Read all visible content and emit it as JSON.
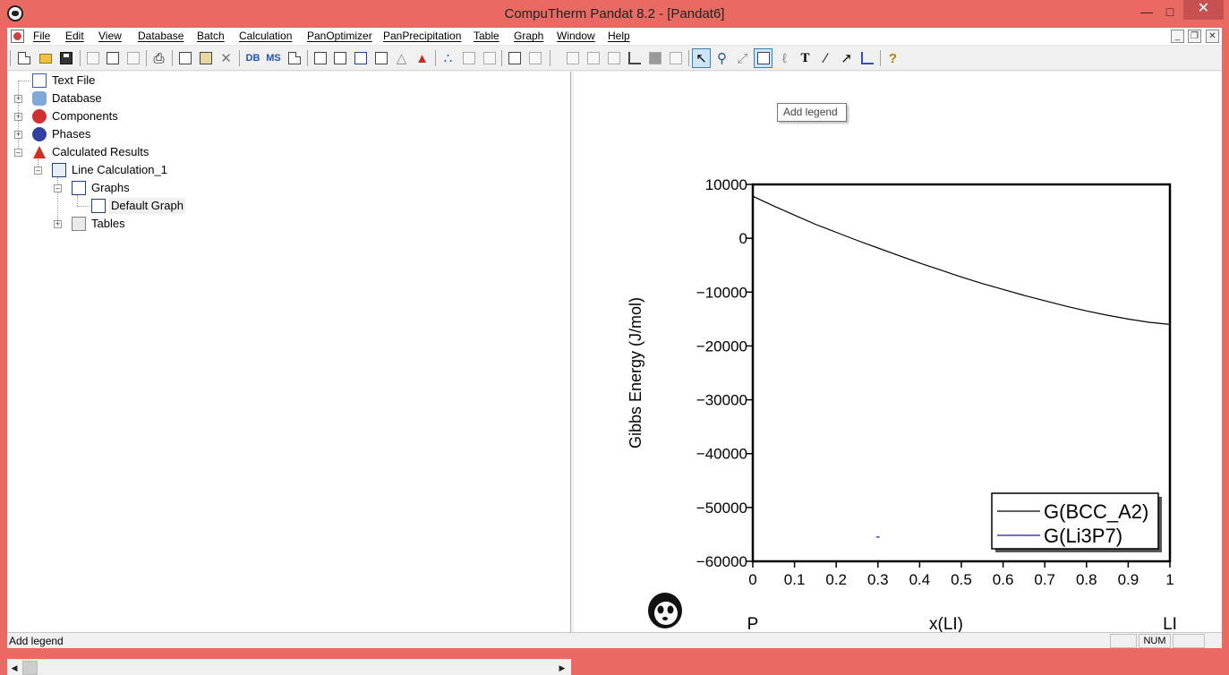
{
  "window": {
    "title": "CompuTherm Pandat 8.2 - [Pandat6]"
  },
  "menu": [
    "File",
    "Edit",
    "View",
    "Database",
    "Batch",
    "Calculation",
    "PanOptimizer",
    "PanPrecipitation",
    "Table",
    "Graph",
    "Window",
    "Help"
  ],
  "toolbar": {
    "db_label": "DB",
    "ms_label": "MS",
    "text_tool_label": "T",
    "help_label": "?",
    "tooltip": "Add legend"
  },
  "tree": {
    "text_file": "Text File",
    "database": "Database",
    "components": "Components",
    "phases": "Phases",
    "calculated_results": "Calculated Results",
    "line_calculation": "Line Calculation_1",
    "graphs": "Graphs",
    "default_graph": "Default Graph",
    "tables": "Tables"
  },
  "chart_data": {
    "type": "line",
    "ylabel": "Gibbs Energy (J/mol)",
    "xlabel": "x(LI)",
    "x_left_label": "P",
    "x_right_label": "LI",
    "xlim": [
      0,
      1
    ],
    "ylim": [
      -60000,
      10000
    ],
    "xticks": [
      "0",
      "0.1",
      "0.2",
      "0.3",
      "0.4",
      "0.5",
      "0.6",
      "0.7",
      "0.8",
      "0.9",
      "1"
    ],
    "yticks": [
      "10000",
      "0",
      "-10000",
      "-20000",
      "-30000",
      "-40000",
      "-50000",
      "-60000"
    ],
    "series": [
      {
        "name": "G(BCC_A2)",
        "color": "#000000",
        "x": [
          0,
          0.05,
          0.1,
          0.15,
          0.2,
          0.25,
          0.3,
          0.35,
          0.4,
          0.45,
          0.5,
          0.55,
          0.6,
          0.65,
          0.7,
          0.75,
          0.8,
          0.85,
          0.9,
          0.95,
          1.0
        ],
        "y": [
          7800,
          6000,
          4300,
          2600,
          1100,
          -400,
          -1800,
          -3200,
          -4600,
          -5900,
          -7200,
          -8400,
          -9500,
          -10600,
          -11600,
          -12600,
          -13500,
          -14300,
          -15000,
          -15600,
          -16000
        ]
      },
      {
        "name": "G(Li3P7)",
        "color": "#1a1aa8",
        "x": [
          0.3
        ],
        "y": [
          -55500
        ]
      }
    ],
    "legend": "bottom-right",
    "grid": false
  },
  "status": {
    "text": "Add legend",
    "num": "NUM"
  }
}
